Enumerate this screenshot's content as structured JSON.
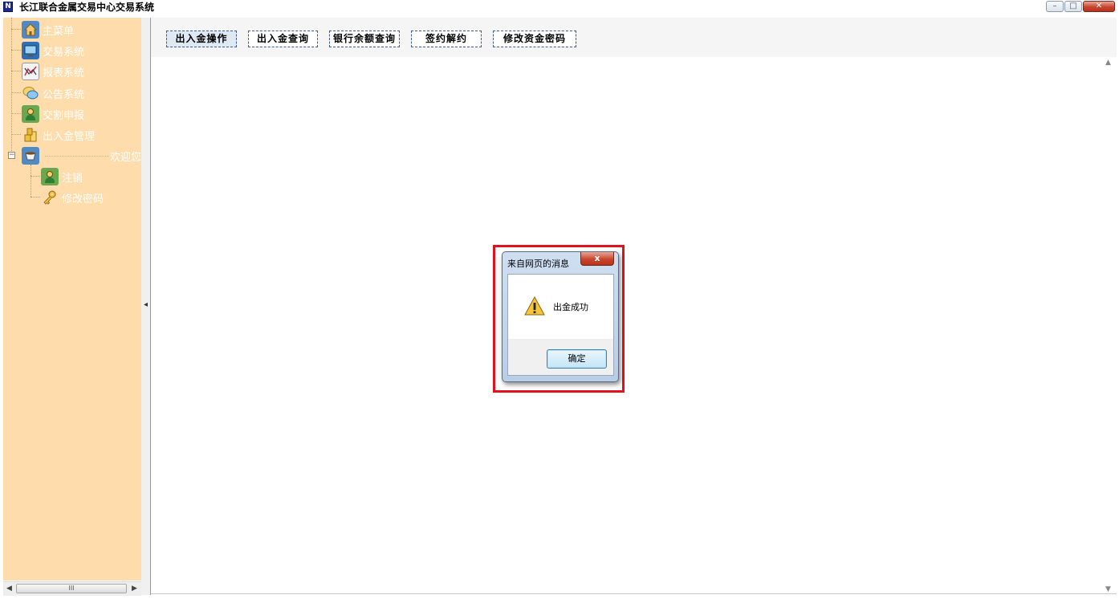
{
  "window": {
    "title": "长江联合金属交易中心交易系统",
    "controls": [
      "minimize",
      "maximize",
      "close"
    ]
  },
  "sidebar": {
    "items": [
      {
        "label": "主菜单",
        "icon": "home-icon"
      },
      {
        "label": "交易系统",
        "icon": "monitor-icon"
      },
      {
        "label": "报表系统",
        "icon": "chart-icon"
      },
      {
        "label": "公告系统",
        "icon": "chat-bubble-icon"
      },
      {
        "label": "交割申报",
        "icon": "user-icon"
      },
      {
        "label": "出入金管理",
        "icon": "coins-icon"
      }
    ],
    "user_node": {
      "icon": "teacup-icon",
      "welcome": "欢迎您",
      "children": [
        {
          "label": "注销",
          "icon": "user-icon"
        },
        {
          "label": "修改密码",
          "icon": "key-icon"
        }
      ]
    },
    "scrollbar_thumb": "III"
  },
  "toolbar": {
    "buttons": [
      {
        "label": "出入金操作",
        "active": true
      },
      {
        "label": "出入金查询",
        "active": false
      },
      {
        "label": "银行余额查询",
        "active": false
      },
      {
        "label": "签约解约",
        "active": false
      },
      {
        "label": "修改资金密码",
        "active": false
      }
    ]
  },
  "dialog": {
    "title": "来自网页的消息",
    "message": "出金成功",
    "icon": "warning-icon",
    "ok_label": "确定",
    "close_glyph": "x"
  },
  "colors": {
    "sidebar_bg": "#ffdcab",
    "highlight": "#e0121b",
    "toolbar_bg": "#f5f5f5"
  }
}
